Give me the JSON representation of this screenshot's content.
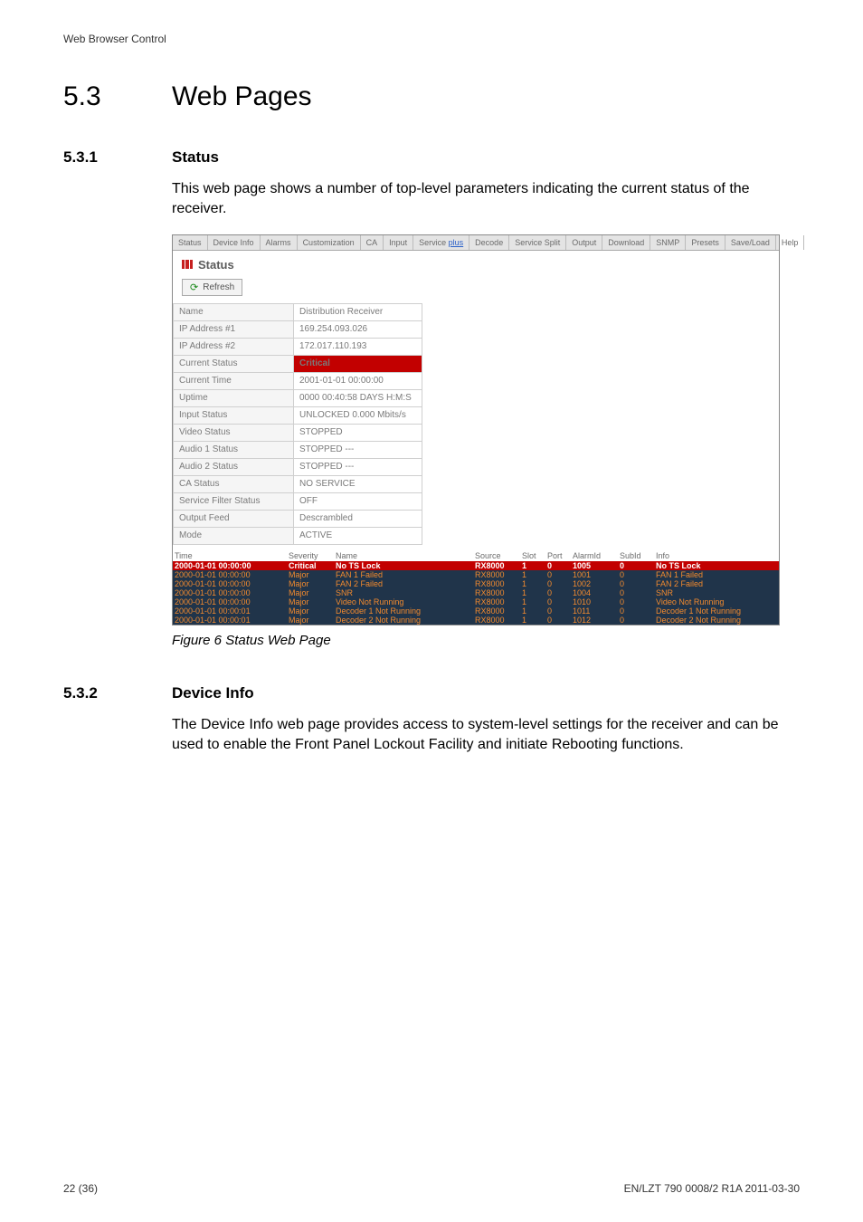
{
  "header_path": "Web Browser Control",
  "h1": {
    "num": "5.3",
    "title": "Web Pages"
  },
  "sec1": {
    "num": "5.3.1",
    "title": "Status",
    "body": "This web page shows a number of top-level parameters indicating the current status of the receiver."
  },
  "fig_caption": "Figure 6     Status Web Page",
  "sec2": {
    "num": "5.3.2",
    "title": "Device Info",
    "body": "The Device Info web page provides access to system-level settings for the receiver and can be used to enable the Front Panel Lockout Facility and initiate Rebooting functions."
  },
  "footer": {
    "left": "22 (36)",
    "right_a": "EN/LZT 790 0008/2 R1A ",
    "right_b": "2011-03-30"
  },
  "shot": {
    "tabs": [
      "Status",
      "Device Info",
      "Alarms",
      "Customization",
      "CA",
      "Input",
      "Service ",
      "plus",
      "Decode",
      "Service Split",
      "Output",
      "Download",
      "SNMP",
      "Presets",
      "Save/Load",
      "Help"
    ],
    "panel_title": "Status",
    "refresh": "Refresh",
    "rows": [
      {
        "k": "Name",
        "v": "Distribution Receiver"
      },
      {
        "k": "IP Address #1",
        "v": "169.254.093.026"
      },
      {
        "k": "IP Address #2",
        "v": "172.017.110.193"
      },
      {
        "k": "Current Status",
        "v": "Critical",
        "crit": true
      },
      {
        "k": "Current Time",
        "v": "2001-01-01 00:00:00"
      },
      {
        "k": "Uptime",
        "v": "0000 00:40:58 DAYS H:M:S"
      },
      {
        "k": "Input Status",
        "v": "UNLOCKED 0.000 Mbits/s"
      },
      {
        "k": "Video Status",
        "v": "STOPPED"
      },
      {
        "k": "Audio 1 Status",
        "v": "STOPPED ---"
      },
      {
        "k": "Audio 2 Status",
        "v": "STOPPED ---"
      },
      {
        "k": "CA Status",
        "v": "NO SERVICE"
      },
      {
        "k": "Service Filter Status",
        "v": "OFF"
      },
      {
        "k": "Output Feed",
        "v": "Descrambled"
      },
      {
        "k": "Mode",
        "v": "ACTIVE"
      }
    ],
    "alarm_head": {
      "time": "Time",
      "sev": "Severity",
      "name": "Name",
      "src": "Source",
      "slot": "Slot",
      "port": "Port",
      "aid": "AlarmId",
      "sid": "SubId",
      "info": "Info"
    },
    "alarms": [
      {
        "t": "2000-01-01 00:00:00",
        "s": "Critical",
        "n": "No TS Lock",
        "src": "RX8000",
        "sl": "1",
        "pt": "0",
        "aid": "1005",
        "sid": "0",
        "inf": "No TS Lock",
        "hl": 0
      },
      {
        "t": "2000-01-01 00:00:00",
        "s": "Major",
        "n": "FAN 1 Failed",
        "src": "RX8000",
        "sl": "1",
        "pt": "0",
        "aid": "1001",
        "sid": "0",
        "inf": "FAN 1 Failed",
        "hl": 1
      },
      {
        "t": "2000-01-01 00:00:00",
        "s": "Major",
        "n": "FAN 2 Failed",
        "src": "RX8000",
        "sl": "1",
        "pt": "0",
        "aid": "1002",
        "sid": "0",
        "inf": "FAN 2 Failed",
        "hl": 1
      },
      {
        "t": "2000-01-01 00:00:00",
        "s": "Major",
        "n": "SNR",
        "src": "RX8000",
        "sl": "1",
        "pt": "0",
        "aid": "1004",
        "sid": "0",
        "inf": "SNR",
        "hl": 1
      },
      {
        "t": "2000-01-01 00:00:00",
        "s": "Major",
        "n": "Video Not Running",
        "src": "RX8000",
        "sl": "1",
        "pt": "0",
        "aid": "1010",
        "sid": "0",
        "inf": "Video Not Running",
        "hl": 1
      },
      {
        "t": "2000-01-01 00:00:01",
        "s": "Major",
        "n": "Decoder 1 Not Running",
        "src": "RX8000",
        "sl": "1",
        "pt": "0",
        "aid": "1011",
        "sid": "0",
        "inf": "Decoder 1 Not Running",
        "hl": 1
      },
      {
        "t": "2000-01-01 00:00:01",
        "s": "Major",
        "n": "Decoder 2 Not Running",
        "src": "RX8000",
        "sl": "1",
        "pt": "0",
        "aid": "1012",
        "sid": "0",
        "inf": "Decoder 2 Not Running",
        "hl": 1
      }
    ]
  }
}
